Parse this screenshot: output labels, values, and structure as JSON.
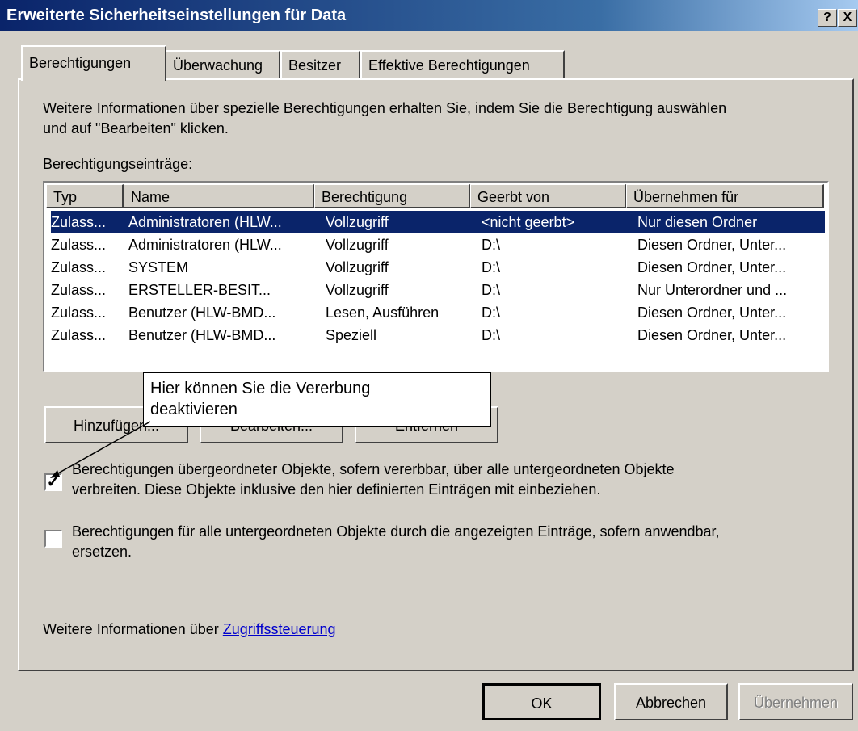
{
  "window": {
    "title": "Erweiterte Sicherheitseinstellungen für Data",
    "help_label": "?",
    "close_label": "X"
  },
  "tabs": [
    {
      "label": "Berechtigungen",
      "active": true
    },
    {
      "label": "Überwachung",
      "active": false
    },
    {
      "label": "Besitzer",
      "active": false
    },
    {
      "label": "Effektive Berechtigungen",
      "active": false
    }
  ],
  "info": {
    "line1": "Weitere Informationen über spezielle Berechtigungen erhalten Sie, indem Sie die Berechtigung auswählen",
    "line2": "und auf \"Bearbeiten\" klicken."
  },
  "entries_label": "Berechtigungseinträge:",
  "list": {
    "columns": [
      "Typ",
      "Name",
      "Berechtigung",
      "Geerbt von",
      "Übernehmen für"
    ],
    "rows": [
      [
        "Zulass...",
        "Administratoren (HLW...",
        "Vollzugriff",
        "<nicht geerbt>",
        "Nur diesen Ordner"
      ],
      [
        "Zulass...",
        "Administratoren (HLW...",
        "Vollzugriff",
        "D:\\",
        "Diesen Ordner, Unter..."
      ],
      [
        "Zulass...",
        "SYSTEM",
        "Vollzugriff",
        "D:\\",
        "Diesen Ordner, Unter..."
      ],
      [
        "Zulass...",
        "ERSTELLER-BESIT...",
        "Vollzugriff",
        "D:\\",
        "Nur Unterordner und ..."
      ],
      [
        "Zulass...",
        "Benutzer (HLW-BMD...",
        "Lesen, Ausführen",
        "D:\\",
        "Diesen Ordner, Unter..."
      ],
      [
        "Zulass...",
        "Benutzer (HLW-BMD...",
        "Speziell",
        "D:\\",
        "Diesen Ordner, Unter..."
      ]
    ],
    "selected_row": 0
  },
  "buttons": {
    "add": "Hinzufügen...",
    "edit": "Bearbeiten...",
    "remove": "Entfernen"
  },
  "callout": {
    "line1": "Hier können Sie die Vererbung",
    "line2": "deaktivieren"
  },
  "inherit_checkbox": {
    "checked": true,
    "line1": "Berechtigungen übergeordneter Objekte, sofern vererbbar, über alle untergeordneten Objekte",
    "line2": "verbreiten. Diese Objekte inklusive den hier definierten Einträgen mit einbeziehen."
  },
  "replace_checkbox": {
    "checked": false,
    "line1": "Berechtigungen für alle untergeordneten Objekte durch die angezeigten Einträge, sofern anwendbar,",
    "line2": "ersetzen."
  },
  "footer_info": {
    "prefix": "Weitere Informationen über ",
    "link": "Zugriffssteuerung"
  },
  "dialog_buttons": {
    "ok": "OK",
    "cancel": "Abbrechen",
    "apply": "Übernehmen"
  },
  "colors": {
    "title_bar": "#0a246a",
    "selection": "#0a246a",
    "dialog_bg": "#d4d0c8",
    "link": "#0000cc"
  }
}
